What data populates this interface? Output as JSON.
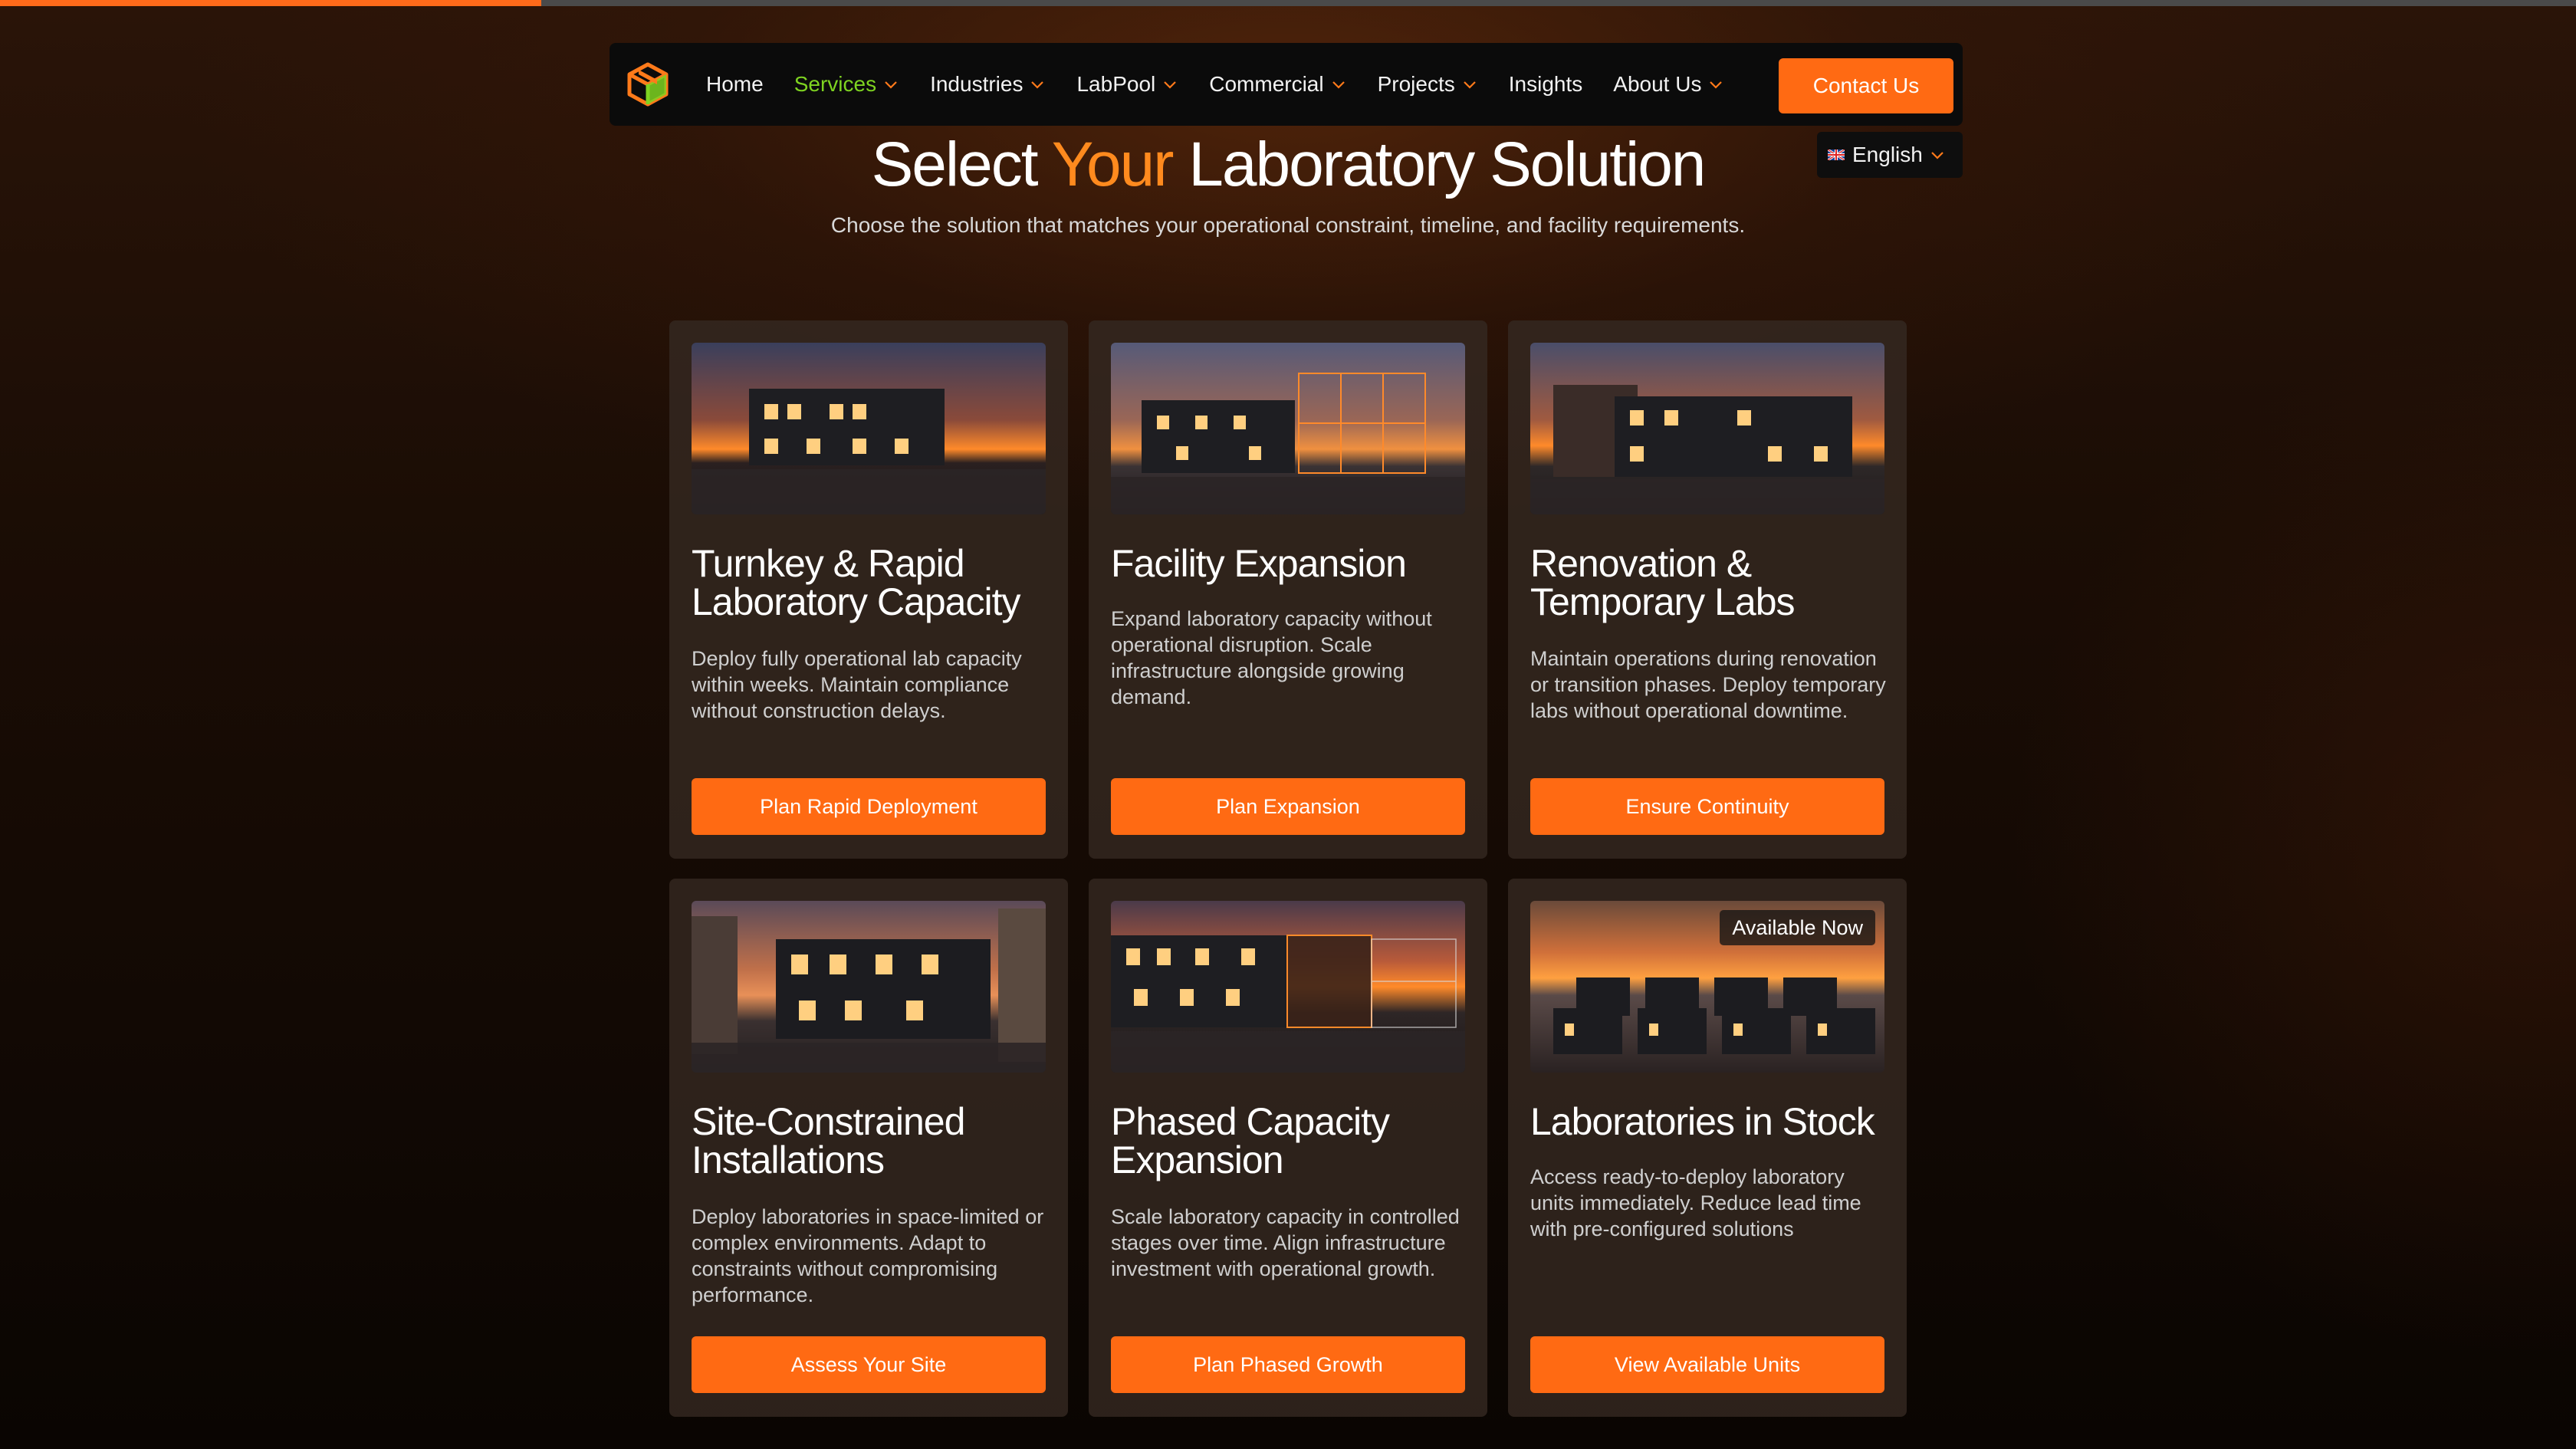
{
  "progress": {
    "fill_fraction": 0.21
  },
  "colors": {
    "accent": "#ff6a13",
    "active_nav": "#7ed321",
    "title_accent": "#ff8a1e"
  },
  "nav": {
    "logo_icon": "cube-logo-icon",
    "items": [
      {
        "label": "Home",
        "dropdown": false,
        "active": false
      },
      {
        "label": "Services",
        "dropdown": true,
        "active": true
      },
      {
        "label": "Industries",
        "dropdown": true,
        "active": false
      },
      {
        "label": "LabPool",
        "dropdown": true,
        "active": false
      },
      {
        "label": "Commercial",
        "dropdown": true,
        "active": false
      },
      {
        "label": "Projects",
        "dropdown": true,
        "active": false
      },
      {
        "label": "Insights",
        "dropdown": false,
        "active": false
      },
      {
        "label": "About Us",
        "dropdown": true,
        "active": false
      }
    ],
    "contact_label": "Contact Us"
  },
  "language": {
    "label": "English",
    "flag_icon": "uk-flag-icon"
  },
  "hero": {
    "title_before": "Select ",
    "title_accent": "Your",
    "title_after": " Laboratory Solution",
    "subtitle": "Choose the solution that matches your operational constraint, timeline, and facility requirements."
  },
  "cards": [
    {
      "title": "Turnkey & Rapid Laboratory Capacity",
      "description": "Deploy fully operational lab capacity within weeks. Maintain compliance without construction delays.",
      "button": "Plan Rapid Deployment",
      "badge": ""
    },
    {
      "title": "Facility Expansion",
      "description": "Expand laboratory capacity without operational disruption. Scale infrastructure alongside growing demand.",
      "button": "Plan Expansion",
      "badge": ""
    },
    {
      "title": "Renovation & Temporary Labs",
      "description": "Maintain operations during renovation or transition phases. Deploy temporary labs without operational downtime.",
      "button": "Ensure Continuity",
      "badge": ""
    },
    {
      "title": "Site-Constrained Installations",
      "description": "Deploy laboratories in space-limited or complex environments. Adapt to constraints without compromising performance.",
      "button": "Assess Your Site",
      "badge": ""
    },
    {
      "title": "Phased Capacity Expansion",
      "description": "Scale laboratory capacity in controlled stages over time. Align infrastructure investment with operational growth.",
      "button": "Plan Phased Growth",
      "badge": ""
    },
    {
      "title": "Laboratories in Stock",
      "description": "Access ready-to-deploy laboratory units immediately. Reduce lead time with pre-configured solutions",
      "button": "View Available Units",
      "badge": "Available Now"
    }
  ]
}
